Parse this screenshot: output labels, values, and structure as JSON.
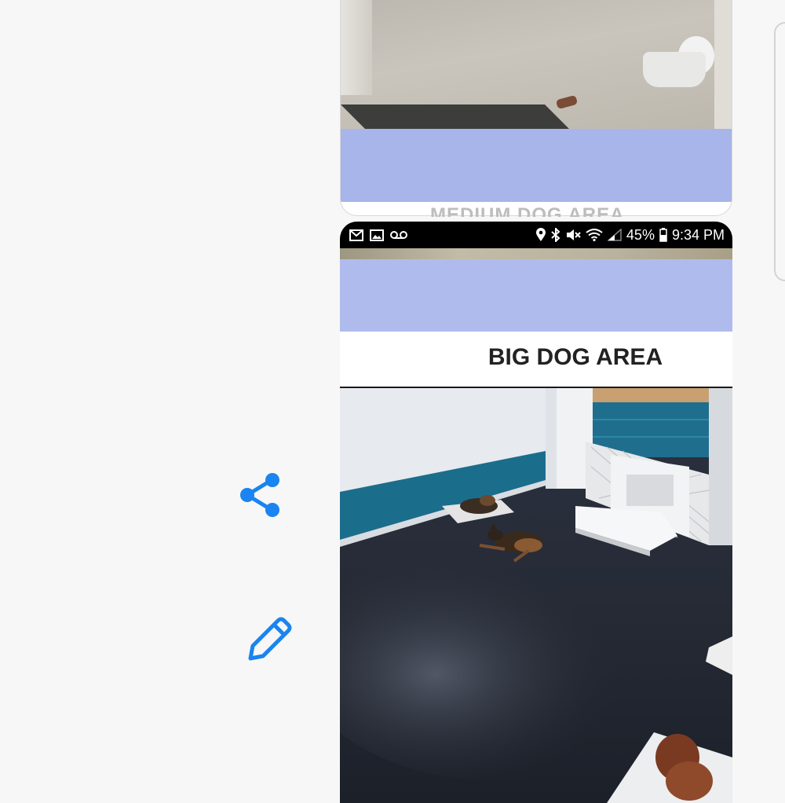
{
  "side_actions": {
    "share_icon": "share-icon",
    "edit_icon": "pencil-icon",
    "accent": "#1a84f0"
  },
  "card_top": {
    "band_color": "#a7b5ea",
    "ghost_text": "MEDIUM DOG AREA"
  },
  "card_bottom": {
    "status_bar": {
      "left_icons": [
        "gmail-icon",
        "gallery-icon",
        "voicemail-icon"
      ],
      "right_icons": [
        "location-icon",
        "bluetooth-icon",
        "mute-icon",
        "wifi-icon",
        "signal-icon"
      ],
      "battery": "45%",
      "time": "9:34 PM"
    },
    "header_color": "#b0bbed",
    "title": "BIG DOG AREA",
    "feed": "camera-feed-big-dog-area"
  }
}
